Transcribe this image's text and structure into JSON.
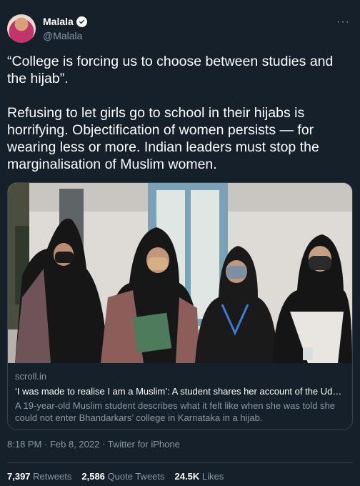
{
  "tweet": {
    "author": {
      "display_name": "Malala",
      "handle": "@Malala",
      "verified_icon": "verified-badge-icon",
      "avatar_colors": [
        "#c2346a",
        "#d8a07a"
      ]
    },
    "more_icon": "more-options-icon",
    "more_label": "···",
    "text_paragraphs": [
      "“College is forcing us to choose between studies and the hijab”.",
      "Refusing to let girls go to school in their hijabs is horrifying. Objectification of women persists — for wearing less or more. Indian leaders must stop the marginalisation of Muslim women."
    ],
    "link_card": {
      "domain": "scroll.in",
      "title": "‘I was made to realise I am a Muslim’: A student shares her account of the Udu…",
      "description": "A 19-year-old Muslim student describes what it felt like when she was told she could not enter Bhandarkars’ college in Karnataka in a hijab."
    },
    "timestamp": "8:18 PM · Feb 8, 2022 · Twitter for iPhone",
    "stats": [
      {
        "count": "7,397",
        "label": "Retweets"
      },
      {
        "count": "2,586",
        "label": "Quote Tweets"
      },
      {
        "count": "24.5K",
        "label": "Likes"
      }
    ]
  },
  "colors": {
    "background": "#15202b",
    "secondary_text": "#8b98a5",
    "border": "#38444d",
    "verified": "#1d9bf0"
  }
}
